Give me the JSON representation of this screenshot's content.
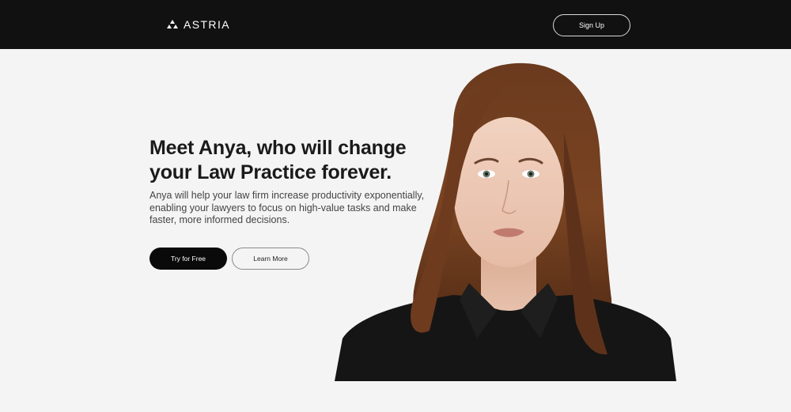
{
  "header": {
    "brand_name": "ASTRIA",
    "logo_icon": "triangle-logo-icon",
    "signup_label": "Sign Up",
    "background_color": "#111111"
  },
  "hero": {
    "title_lines": [
      "Meet Anya, who will change",
      "your Law Practice forever."
    ],
    "subtitle_lines": [
      "Anya will help your law firm increase productivity exponentially,",
      "enabling your lawyers to focus on high-value tasks and make",
      "faster, more informed decisions."
    ],
    "primary_button_label": "Try for Free",
    "secondary_button_label": "Learn More"
  },
  "colors": {
    "page_background": "#f4f4f4",
    "primary_button": "#0a0a0a",
    "text_dark": "#1a1a1a"
  }
}
